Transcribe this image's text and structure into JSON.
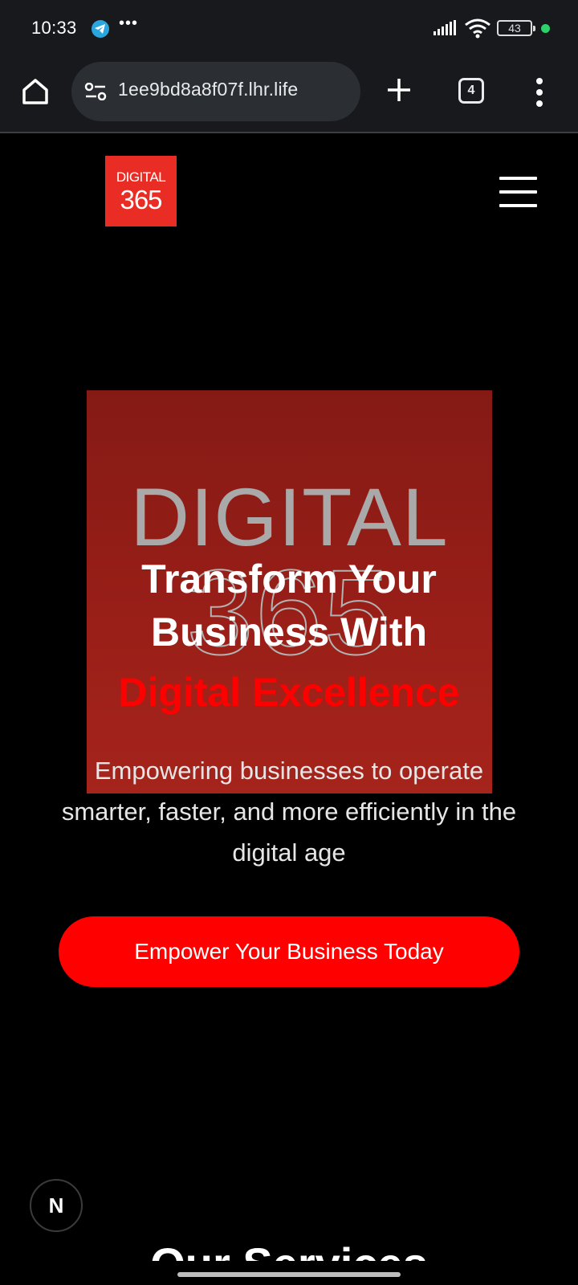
{
  "status_bar": {
    "time": "10:33",
    "more": "•••",
    "battery": "43"
  },
  "browser": {
    "url": "1ee9bd8a8f07f.lhr.life",
    "tab_count": "4"
  },
  "site": {
    "logo_line1": "DIGITAL",
    "logo_line2": "365"
  },
  "hero": {
    "image_text_top": "DIGITAL",
    "image_text_bottom": "365",
    "title_line1": "Transform Your",
    "title_line2": "Business With",
    "title_accent": "Digital Excellence",
    "subtitle": "Empowering businesses to operate smarter, faster, and more efficiently in the digital age",
    "cta_label": "Empower Your Business Today"
  },
  "badge": {
    "label": "N"
  },
  "section": {
    "title": "Our Services"
  },
  "colors": {
    "accent": "#ff0000",
    "logo_bg": "#ea2d24",
    "hero_image_bg": "#9a1f18",
    "chrome_bg": "#17191d"
  }
}
